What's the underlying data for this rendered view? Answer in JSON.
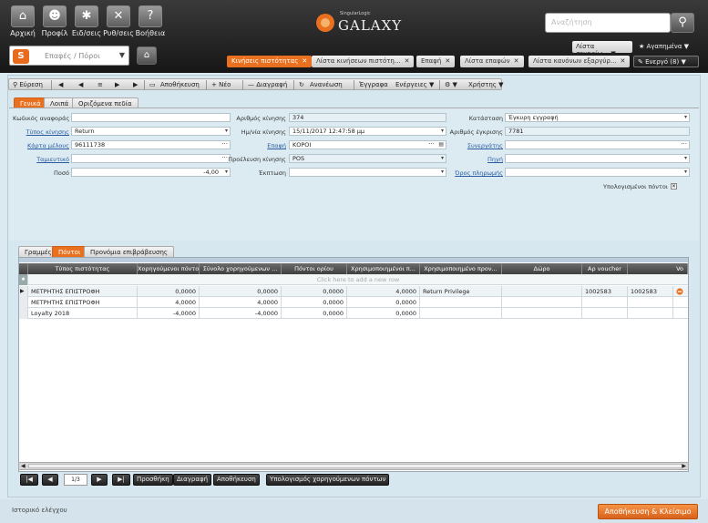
{
  "nav": [
    {
      "label": "Αρχική",
      "icon": "home-icon",
      "glyph": "⌂"
    },
    {
      "label": "Προφίλ",
      "icon": "profile-icon",
      "glyph": "☻"
    },
    {
      "label": "Ειδ/σεις",
      "icon": "gear-icon",
      "glyph": "✱"
    },
    {
      "label": "Ρυθ/σεις",
      "icon": "tools-icon",
      "glyph": "✕"
    },
    {
      "label": "Βοήθεια",
      "icon": "help-icon",
      "glyph": "?"
    }
  ],
  "logo": {
    "brand": "SingularLogic",
    "name": "GALAXY"
  },
  "search": {
    "placeholder": "Αναζήτηση",
    "icon": "search-icon"
  },
  "scenario_btn": "Λίστα σεναρίω... ▼",
  "favorites_btn": "★ Αγαπημένα ▼",
  "module": {
    "label": "Επαφές / Πόροι",
    "icon": "contacts-module-icon"
  },
  "tabs": [
    {
      "label": "Κινήσεις πιστότητας",
      "active": true
    },
    {
      "label": "Λίστα κινήσεων πιστότη...",
      "active": false
    },
    {
      "label": "Επαφή",
      "active": false
    },
    {
      "label": "Λίστα επαφών",
      "active": false
    },
    {
      "label": "Λίστα κανόνων εξαργύρ...",
      "active": false
    }
  ],
  "active_count": "✎ Ενεργό (8) ▼",
  "toolbar": {
    "search": "⚲ Εύρεση",
    "first": "◀",
    "prev": "◀",
    "list": "≡",
    "next": "▶",
    "last": "▶",
    "save": "Αποθήκευση",
    "new": "+ Νέο",
    "delete": "— Διαγραφή",
    "refresh": "Ανανέωση",
    "documents": "Έγγραφα",
    "actions": "Ενέργειες ▼",
    "settings": "⚙ ▼",
    "user": "Χρήστης ▼"
  },
  "form_tabs": [
    "Γενικά",
    "Λοιπά",
    "Οριζόμενα πεδία"
  ],
  "form": {
    "ref_code_label": "Κωδικός αναφοράς",
    "ref_code": "",
    "move_type_label": "Τύπος κίνησης",
    "move_type": "Return",
    "card_label": "Κάρτα μέλους",
    "card": "96111738",
    "store_label": "Ταμιευτικό",
    "store": "",
    "amount_label": "Ποσό",
    "amount": "-4,00",
    "move_no_label": "Αριθμός κίνησης",
    "move_no": "374",
    "move_date_label": "Ημ/νία κίνησης",
    "move_date": "15/11/2017 12:47:58 μμ",
    "contact_label": "Επαφή",
    "contact": "ΚΟΡΟΙ",
    "origin_label": "Προέλευση κίνησης",
    "origin": "POS",
    "discount_label": "Έκπτωση",
    "discount": "",
    "status_label": "Κατάσταση",
    "status": "Έγκυρη εγγραφή",
    "approval_label": "Αριθμός έγκρισης",
    "approval": "7781",
    "partner_label": "Συνεργάτης",
    "partner": "",
    "source_label": "Πηγή",
    "source": "",
    "payment_label": "Όρος πληρωμής",
    "payment": "",
    "calc_points_label": "Υπολογισμένοι πόντοι"
  },
  "grid_tabs": [
    "Γραμμές",
    "Πόντοι",
    "Προνόμια επιβράβευσης"
  ],
  "grid": {
    "columns": [
      "Τύπος πιστότητας",
      "Χορηγούμενοι πόντοι",
      "Σύνολο χορηγούμενων ...",
      "Πόντοι ορίου",
      "Χρησιμοποιημένοι π...",
      "Χρησιμοποιημένο προν...",
      "Δώρο",
      "Αρ voucher",
      "Vo"
    ],
    "add_row": "Click here to add a new row",
    "rows": [
      [
        "ΜΕΤΡΗΤΗΣ ΕΠΙΣΤΡΟΦΗ",
        "0,0000",
        "0,0000",
        "0,0000",
        "4,0000",
        "Return Privilege",
        "",
        "1002583",
        "1002583"
      ],
      [
        "ΜΕΤΡΗΤΗΣ ΕΠΙΣΤΡΟΦΗ",
        "4,0000",
        "4,0000",
        "0,0000",
        "0,0000",
        "",
        "",
        "",
        ""
      ],
      [
        "Loyalty 2018",
        "-4,0000",
        "-4,0000",
        "0,0000",
        "0,0000",
        "",
        "",
        "",
        ""
      ]
    ]
  },
  "pager": {
    "first": "|◀",
    "prev": "◀",
    "page": "1/3",
    "next": "▶",
    "last": "▶|",
    "add": "Προσθήκη",
    "delete": "Διαγραφή",
    "save": "Αποθήκευση",
    "calc": "Υπολογισμός χορηγούμενων πόντων"
  },
  "history": "Ιστορικό ελέγχου",
  "save_close": "Αποθήκευση & Κλείσιμο",
  "colors": {
    "accent": "#e8701e",
    "header": "#1f1f1f",
    "panel": "#d6e7ef"
  }
}
